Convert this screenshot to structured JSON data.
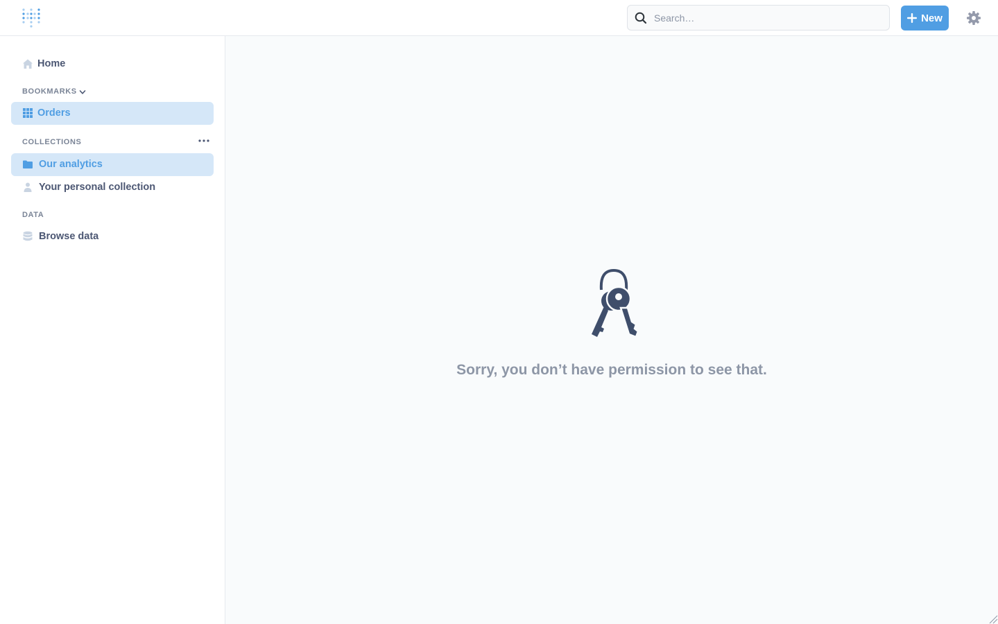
{
  "header": {
    "search_placeholder": "Search…",
    "new_button_label": "New"
  },
  "sidebar": {
    "home_label": "Home",
    "bookmarks_title": "BOOKMARKS",
    "bookmarks": [
      {
        "label": "Orders",
        "icon": "grid-icon",
        "active": true
      }
    ],
    "collections_title": "COLLECTIONS",
    "collections": [
      {
        "label": "Our analytics",
        "icon": "folder-icon",
        "active": true
      },
      {
        "label": "Your personal collection",
        "icon": "person-icon",
        "active": false
      }
    ],
    "data_title": "DATA",
    "data_items": [
      {
        "label": "Browse data",
        "icon": "database-icon"
      }
    ]
  },
  "main": {
    "message": "Sorry, you don’t have permission to see that."
  },
  "colors": {
    "brand": "#509ee3",
    "active_bg": "#d5e7f8",
    "text": "#4c5773",
    "muted": "#8d96a6",
    "icon_dark": "#3f4e6b"
  }
}
